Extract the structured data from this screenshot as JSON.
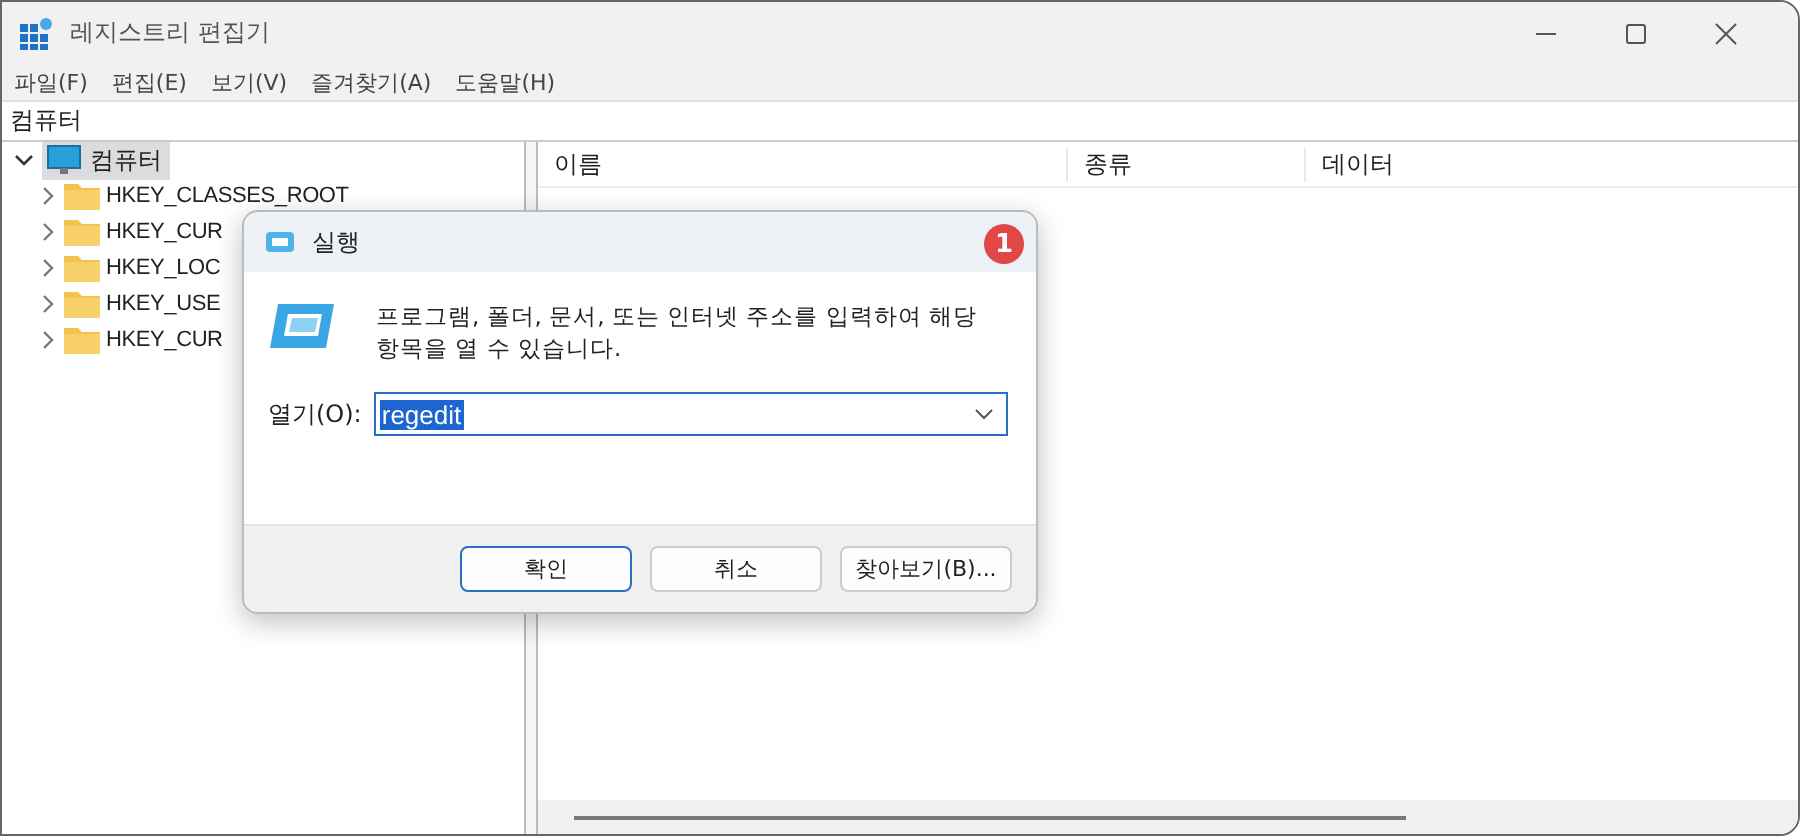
{
  "window": {
    "title": "레지스트리 편집기"
  },
  "menu": [
    "파일(F)",
    "편집(E)",
    "보기(V)",
    "즐겨찾기(A)",
    "도움말(H)"
  ],
  "address": "컴퓨터",
  "tree": {
    "label": "컴퓨터",
    "expanded": true,
    "selected": true,
    "children": [
      {
        "label": "HKEY_CLASSES_ROOT",
        "expanded": false
      },
      {
        "label": "HKEY_CUR",
        "expanded": false
      },
      {
        "label": "HKEY_LOC",
        "expanded": false
      },
      {
        "label": "HKEY_USE",
        "expanded": false
      },
      {
        "label": "HKEY_CUR",
        "expanded": false
      }
    ]
  },
  "columns": [
    "이름",
    "종류",
    "데이터"
  ],
  "dialog": {
    "title": "실행",
    "message": "프로그램, 폴더, 문서, 또는 인터넷 주소를 입력하여 해당 항목을 열 수 있습니다.",
    "open_label": "열기(O):",
    "open_value": "regedit",
    "buttons": [
      {
        "label": "확인",
        "default": true
      },
      {
        "label": "취소",
        "default": false
      },
      {
        "label": "찾아보기(B)...",
        "default": false
      }
    ],
    "badge": "1"
  }
}
